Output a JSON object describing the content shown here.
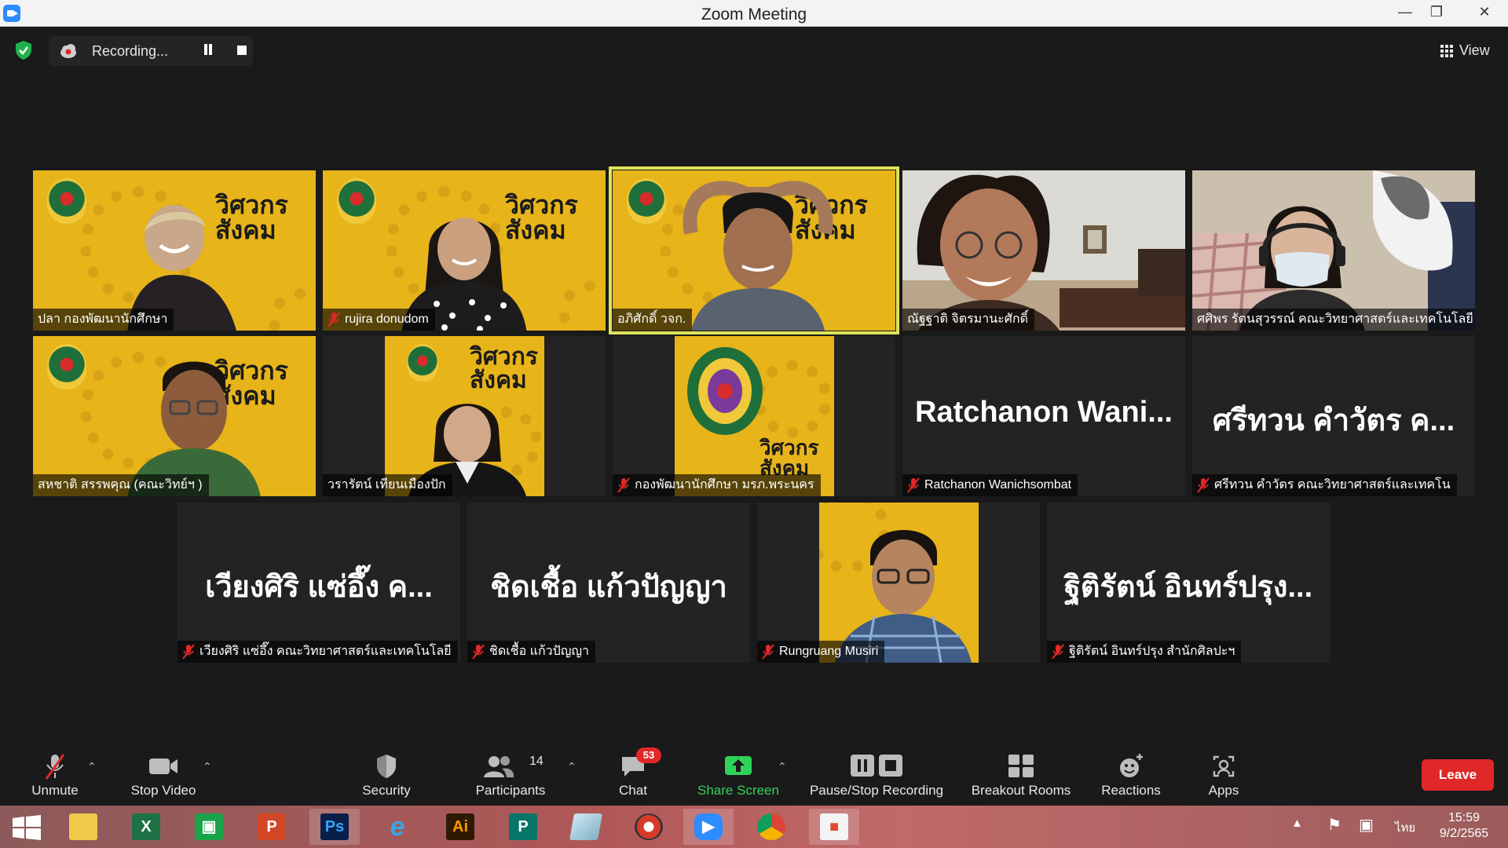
{
  "window": {
    "title": "Zoom Meeting"
  },
  "top_bar": {
    "recording_label": "Recording...",
    "view_label": "View"
  },
  "tiles": [
    {
      "name": "ปลา กองพัฒนานักศึกษา",
      "muted": false
    },
    {
      "name": "rujira donudom",
      "muted": true
    },
    {
      "name": "อภิศักดิ์ วจก.",
      "muted": false,
      "active_speaker": true
    },
    {
      "name": "ณัฐฐาติ จิตรมานะศักดิ์",
      "muted": false
    },
    {
      "name": "ศศิพร รัตนสุวรรณ์ คณะวิทยาศาสตร์และเทคโนโลยี",
      "muted": false
    },
    {
      "name": "สหชาติ สรรพคุณ (คณะวิทย์ฯ )",
      "muted": false
    },
    {
      "name": "วรารัตน์ เทียนเมืองปัก",
      "muted": false
    },
    {
      "name": "กองพัฒนานักศึกษา มรภ.พระนคร",
      "muted": true
    },
    {
      "name": "Ratchanon Wanichsombat",
      "display": "Ratchanon Wani...",
      "muted": true
    },
    {
      "name": "ศรีทวน คำวัตร คณะวิทยาศาสตร์และเทคโน",
      "display": "ศรีทวน คำวัตร ค...",
      "muted": true
    },
    {
      "name": "เวียงศิริ แซ่อึ๊ง คณะวิทยาศาสตร์และเทคโนโลยี",
      "display": "เวียงศิริ แซ่อึ๊ง ค...",
      "muted": true
    },
    {
      "name": "ชิดเชื้อ แก้วปัญญา",
      "display": "ชิดเชื้อ แก้วปัญญา",
      "muted": true
    },
    {
      "name": "Rungruang Musiri",
      "muted": true
    },
    {
      "name": "ฐิติรัตน์ อินทร์ปรุง สำนักศิลปะฯ",
      "display": "ฐิติรัตน์ อินทร์ปรุง...",
      "muted": true
    }
  ],
  "banner": {
    "line1": "วิศวกร",
    "line2": "สังคม"
  },
  "toolbar": {
    "unmute": "Unmute",
    "stop_video": "Stop Video",
    "security": "Security",
    "participants": "Participants",
    "participants_count": "14",
    "chat": "Chat",
    "chat_badge": "53",
    "share_screen": "Share Screen",
    "recording": "Pause/Stop Recording",
    "breakout": "Breakout Rooms",
    "reactions": "Reactions",
    "apps": "Apps",
    "leave": "Leave"
  },
  "taskbar": {
    "apps": [
      "windows-start",
      "file-explorer",
      "excel",
      "store",
      "powerpoint",
      "photoshop",
      "internet-explorer",
      "illustrator",
      "publisher",
      "notes",
      "photoscape",
      "zoom",
      "chrome",
      "photos"
    ],
    "ps_label": "Ps",
    "ai_label": "Ai",
    "language": "ไทย",
    "time": "15:59",
    "date": "9/2/2565"
  },
  "colors": {
    "accent_green": "#2fd35a",
    "leave_red": "#e02828",
    "active_outline": "#dfe35a",
    "tile_yellow": "#e7b41a"
  }
}
